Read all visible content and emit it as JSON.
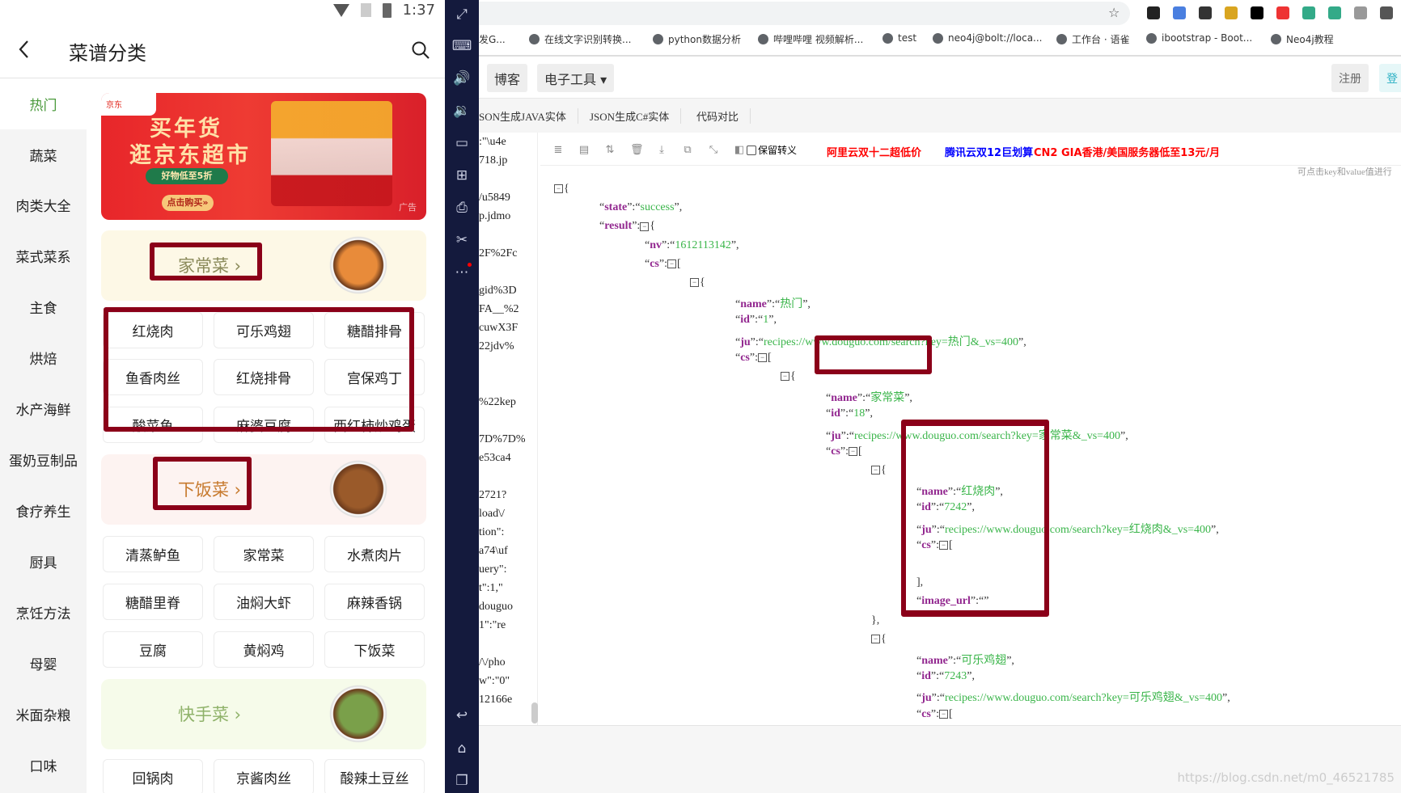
{
  "phone": {
    "status": {
      "time": "1:37",
      "icons": [
        "wifi-icon",
        "no-sim-icon",
        "battery-charging-icon"
      ]
    },
    "header": {
      "title": "菜谱分类",
      "back_icon": "chevron-left-icon",
      "search_icon": "search-icon"
    },
    "sidebar": {
      "active": 0,
      "items": [
        "热门",
        "蔬菜",
        "肉类大全",
        "菜式菜系",
        "主食",
        "烘焙",
        "水产海鲜",
        "蛋奶豆制品",
        "食疗养生",
        "厨具",
        "烹饪方法",
        "母婴",
        "米面杂粮",
        "口味"
      ]
    },
    "banner": {
      "line1": "买年货",
      "line2": "逛京东超市",
      "badge": "好物低至5折",
      "cta": "点击购买»",
      "ad_label": "广告",
      "brand": "京东"
    },
    "sections": [
      {
        "title": "家常菜 ›",
        "color": "#8a8a5a",
        "bg": "#fdf8e6",
        "dishes": [
          "红烧肉",
          "可乐鸡翅",
          "糖醋排骨",
          "鱼香肉丝",
          "红烧排骨",
          "宫保鸡丁",
          "酸菜鱼",
          "麻婆豆腐",
          "西红柿炒鸡蛋"
        ]
      },
      {
        "title": "下饭菜 ›",
        "color": "#c77a2e",
        "bg": "#fdf3f1",
        "dishes": [
          "清蒸鲈鱼",
          "家常菜",
          "水煮肉片",
          "糖醋里脊",
          "油焖大虾",
          "麻辣香锅",
          "豆腐",
          "黄焖鸡",
          "下饭菜"
        ]
      },
      {
        "title": "快手菜 ›",
        "color": "#8fb26a",
        "bg": "#f6fbea",
        "dishes": [
          "回锅肉",
          "京酱肉丝",
          "酸辣土豆丝"
        ]
      }
    ]
  },
  "emulator_toolbar": {
    "icons": [
      "fullscreen-icon",
      "keyboard-icon",
      "volume-up-icon",
      "volume-down-icon",
      "screen-icon",
      "install-apk-icon",
      "print-icon",
      "scissors-icon",
      "more-icon",
      "back-icon",
      "home-icon",
      "recents-icon"
    ]
  },
  "browser": {
    "bookmarks": [
      "发G...",
      "在线文字识别转换...",
      "python数据分析",
      "哔哩哔哩 视频解析...",
      "test",
      "neo4j@bolt://loca...",
      "工作台 · 语雀",
      "ibootstrap - Boot...",
      "Neo4j教程"
    ],
    "nav": {
      "blog": "博客",
      "tools": "电子工具 ▾",
      "register": "注册",
      "login": "登"
    },
    "submenu": [
      "SON生成JAVA实体",
      "JSON生成C#实体",
      "代码对比"
    ],
    "left_text": [
      ":\"\\u4e",
      "718.jp",
      "",
      "/u5849",
      "p.jdmo",
      "",
      "2F%2Fc",
      "",
      "gid%3D",
      "FA__%2",
      "cuwX3F",
      "22jdv%",
      "",
      "",
      "%22kep",
      "",
      "7D%7D%",
      "e53ca4",
      "",
      "2721?",
      "load\\/",
      "tion\":",
      "a74\\uf",
      "uery\":",
      "t\":1,\"",
      "douguo",
      "1\":\"re",
      "",
      "/\\/pho",
      "w\":\"0\"",
      "12166e"
    ],
    "toolbar": {
      "icons": [
        "database-icon",
        "excel-icon",
        "sort-icon",
        "trash-icon",
        "download-icon",
        "copy-icon",
        "compress-icon",
        "collapse-icon"
      ],
      "checkbox_label": "保留转义",
      "checkbox_checked": false,
      "ads": [
        {
          "text": "阿里云双十二超低价",
          "color": "#ff0000"
        },
        {
          "text": "腾讯云双12巨划算",
          "color": "#0000ff"
        },
        {
          "text": "CN2 GIA香港/美国服务器低至13元/月",
          "color": "#ff0000"
        }
      ]
    },
    "hint": "可点击key和value值进行",
    "json_lines": [
      {
        "i": 0,
        "f": "{"
      },
      {
        "i": 1,
        "k": "state",
        "v": "success",
        "e": ","
      },
      {
        "i": 1,
        "k": "result",
        "f": "{"
      },
      {
        "i": 2,
        "k": "nv",
        "v": "1612113142",
        "e": ","
      },
      {
        "i": 2,
        "k": "cs",
        "f": "["
      },
      {
        "i": 3,
        "f": "{"
      },
      {
        "i": 4,
        "k": "name",
        "v": "热门",
        "e": ","
      },
      {
        "i": 4,
        "k": "id",
        "v": "1",
        "e": ","
      },
      {
        "i": 4,
        "k": "ju",
        "v": "recipes://www.douguo.com/search?key=热门&_vs=400",
        "e": ","
      },
      {
        "i": 4,
        "k": "cs",
        "f": "["
      },
      {
        "i": 5,
        "f": "{"
      },
      {
        "i": 6,
        "k": "name",
        "v": "家常菜",
        "e": ","
      },
      {
        "i": 6,
        "k": "id",
        "v": "18",
        "e": ","
      },
      {
        "i": 6,
        "k": "ju",
        "v": "recipes://www.douguo.com/search?key=家常菜&_vs=400",
        "e": ","
      },
      {
        "i": 6,
        "k": "cs",
        "f": "["
      },
      {
        "i": 7,
        "f": "{"
      },
      {
        "i": 8,
        "k": "name",
        "v": "红烧肉",
        "e": ","
      },
      {
        "i": 8,
        "k": "id",
        "v": "7242",
        "e": ","
      },
      {
        "i": 8,
        "k": "ju",
        "v": "recipes://www.douguo.com/search?key=红烧肉&_vs=400",
        "e": ","
      },
      {
        "i": 8,
        "k": "cs",
        "f": "["
      },
      {
        "i": 8,
        "t": ""
      },
      {
        "i": 8,
        "t": "],"
      },
      {
        "i": 8,
        "k": "image_url",
        "v": "",
        "e": ""
      },
      {
        "i": 7,
        "t": "},"
      },
      {
        "i": 7,
        "f": "{"
      },
      {
        "i": 8,
        "k": "name",
        "v": "可乐鸡翅",
        "e": ","
      },
      {
        "i": 8,
        "k": "id",
        "v": "7243",
        "e": ","
      },
      {
        "i": 8,
        "k": "ju",
        "v": "recipes://www.douguo.com/search?key=可乐鸡翅&_vs=400",
        "e": ","
      },
      {
        "i": 8,
        "k": "cs",
        "f": "["
      }
    ],
    "watermark": "https://blog.csdn.net/m0_46521785"
  },
  "colors": {
    "highlight_box": "#8b0019",
    "json_key": "#92278f",
    "json_string": "#3ab54a",
    "active_category": "#4b9a3c",
    "emulator_bar": "#141a3d"
  }
}
